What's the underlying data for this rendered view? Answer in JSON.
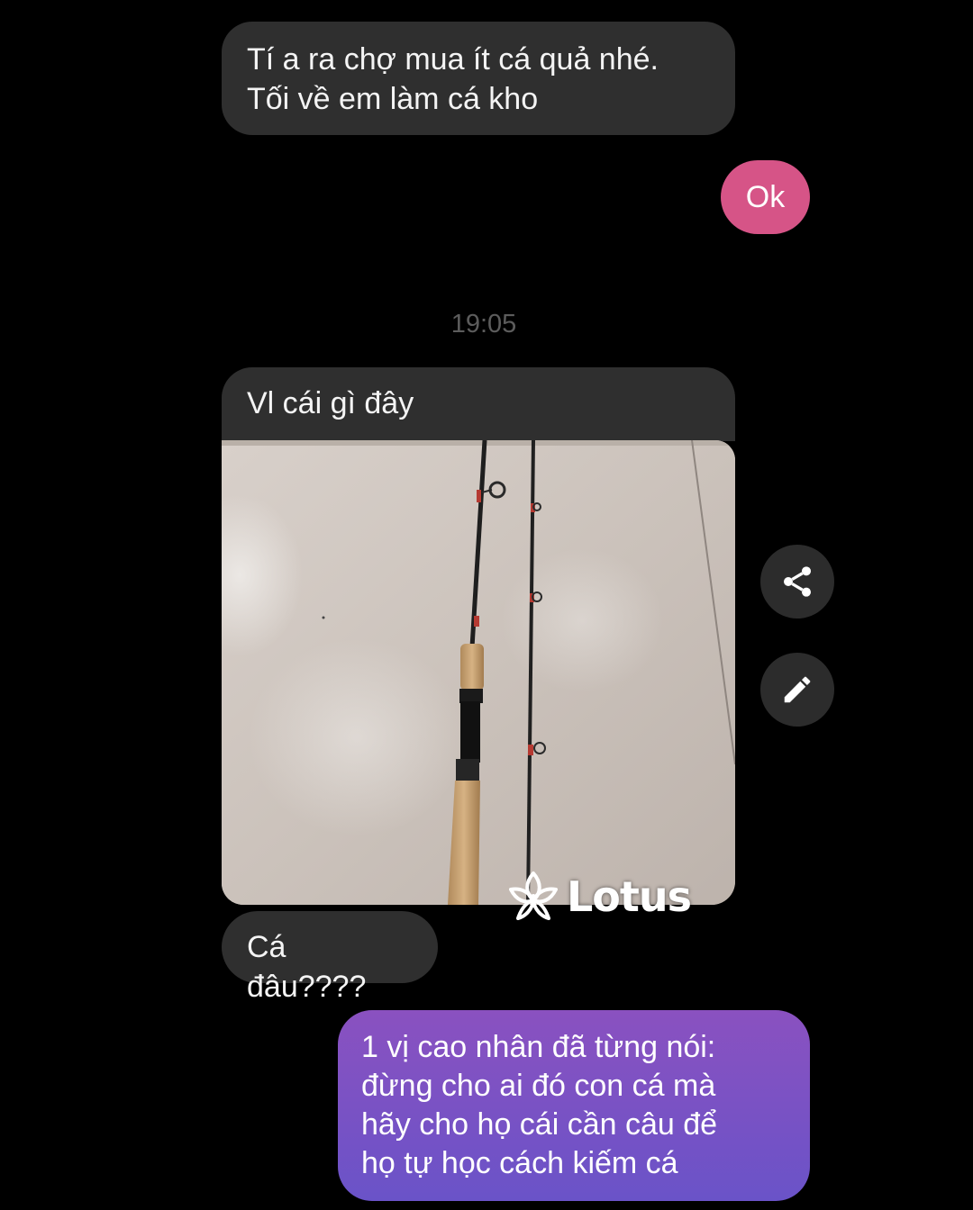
{
  "messages": {
    "m1": "Tí a ra chợ mua ít cá quả nhé.\nTối về em làm cá kho",
    "m2": "Ok",
    "timestamp": "19:05",
    "m3": "Vl cái gì đây",
    "m4": "Cá đâu????",
    "m5": "1 vị cao nhân đã từng nói:\nđừng cho ai đó con cá mà\nhãy cho họ cái cần câu để\nhọ tự học cách kiếm cá"
  },
  "actions": {
    "share_icon": "share-icon",
    "edit_icon": "pencil-icon"
  },
  "watermark": {
    "text": "Lotus",
    "icon": "lotus-flower-icon"
  },
  "colors": {
    "background": "#000000",
    "incoming_bubble": "#2f2f2f",
    "outgoing_pink": "#d65487",
    "outgoing_gradient_top": "#8a51c0",
    "outgoing_gradient_bottom": "#6a53c8"
  }
}
